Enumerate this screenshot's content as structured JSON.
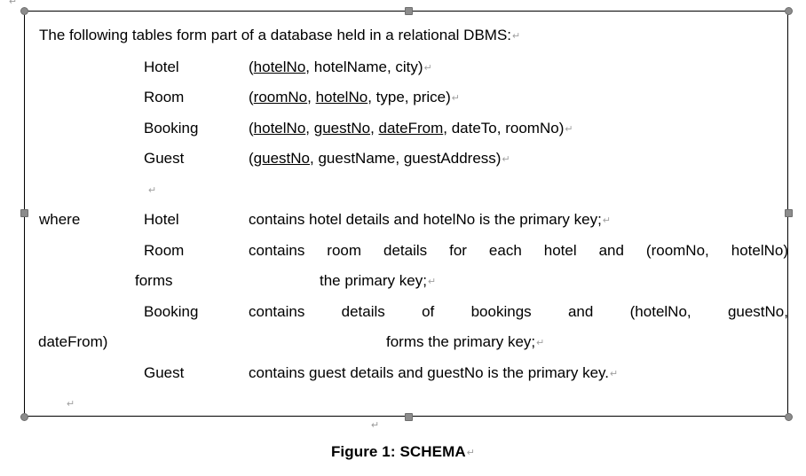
{
  "document": {
    "pilcrow_glyph": "↵",
    "stray_pilcrow": "↵"
  },
  "frame": {
    "intro": {
      "text": "The following tables form part of a database held in a relational DBMS:",
      "pilcrow": "↵"
    },
    "schema_heading_blank": {
      "pilcrow": "↵"
    },
    "schema": [
      {
        "relation": "Hotel",
        "open_paren": "(",
        "attributes": [
          {
            "name": "hotelNo",
            "key": true
          },
          {
            "name": "hotelName",
            "key": false
          },
          {
            "name": "city",
            "key": false
          }
        ],
        "close_paren": ")",
        "pilcrow": "↵"
      },
      {
        "relation": "Room",
        "open_paren": "(",
        "attributes": [
          {
            "name": "roomNo",
            "key": true
          },
          {
            "name": "hotelNo",
            "key": true
          },
          {
            "name": "type",
            "key": false
          },
          {
            "name": "price",
            "key": false
          }
        ],
        "close_paren": ")",
        "pilcrow": "↵"
      },
      {
        "relation": "Booking",
        "open_paren": "(",
        "attributes": [
          {
            "name": "hotelNo",
            "key": true
          },
          {
            "name": "guestNo",
            "key": true
          },
          {
            "name": "dateFrom",
            "key": true
          },
          {
            "name": "dateTo",
            "key": false
          },
          {
            "name": "roomNo",
            "key": false
          }
        ],
        "close_paren": ")",
        "pilcrow": "↵"
      },
      {
        "relation": "Guest",
        "open_paren": "(",
        "attributes": [
          {
            "name": "guestNo",
            "key": true
          },
          {
            "name": "guestName",
            "key": false
          },
          {
            "name": "guestAddress",
            "key": false
          }
        ],
        "close_paren": ")",
        "pilcrow": "↵"
      }
    ],
    "where_keyword": "where",
    "where": [
      {
        "relation": "Hotel",
        "description": "contains hotel details and hotelNo is the primary key;",
        "pilcrow": "↵"
      },
      {
        "relation": "Room",
        "description": "contains room details for each hotel and (roomNo, hotelNo)",
        "continuation_left": "forms",
        "continuation_right": "the primary key;",
        "continuation_pilcrow": "↵"
      },
      {
        "relation": "Booking",
        "description": "contains details of bookings and (hotelNo, guestNo,",
        "continuation_left": "dateFrom)",
        "continuation_right": "forms the primary key;",
        "continuation_pilcrow": "↵"
      },
      {
        "relation": "Guest",
        "description": "contains guest details and guestNo is the primary key.",
        "pilcrow": "↵"
      }
    ],
    "trailing_blank": {
      "pilcrow": "↵"
    }
  },
  "caption": {
    "above_pilcrow": "↵",
    "text": "Figure 1: SCHEMA",
    "pilcrow": "↵"
  },
  "colors": {
    "text": "#000000",
    "frame_border": "#000000",
    "handle_fill": "#8c8c8c",
    "pilcrow": "#a0a0a0",
    "background": "#ffffff"
  }
}
